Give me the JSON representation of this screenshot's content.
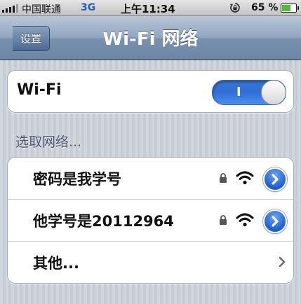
{
  "status_bar": {
    "carrier": "中国联通",
    "network": "3G",
    "time": "上午11:34",
    "battery_percent": "65 %",
    "icons": [
      "signal-icon",
      "rotation-lock-icon",
      "battery-icon"
    ]
  },
  "nav": {
    "back_label": "设置",
    "title": "Wi-Fi 网络"
  },
  "wifi": {
    "label": "Wi-Fi",
    "toggle_on_label": "I",
    "enabled": true
  },
  "networks_section": {
    "header": "选取网络...",
    "items": [
      {
        "name": "密码是我学号",
        "secured": true
      },
      {
        "name": "他学号是20112964",
        "secured": true
      }
    ],
    "other_label": "其他..."
  },
  "colors": {
    "toggle_on": "#2e6fd9",
    "nav_bar": "#6d86a5",
    "background": "#c5ccd4"
  }
}
